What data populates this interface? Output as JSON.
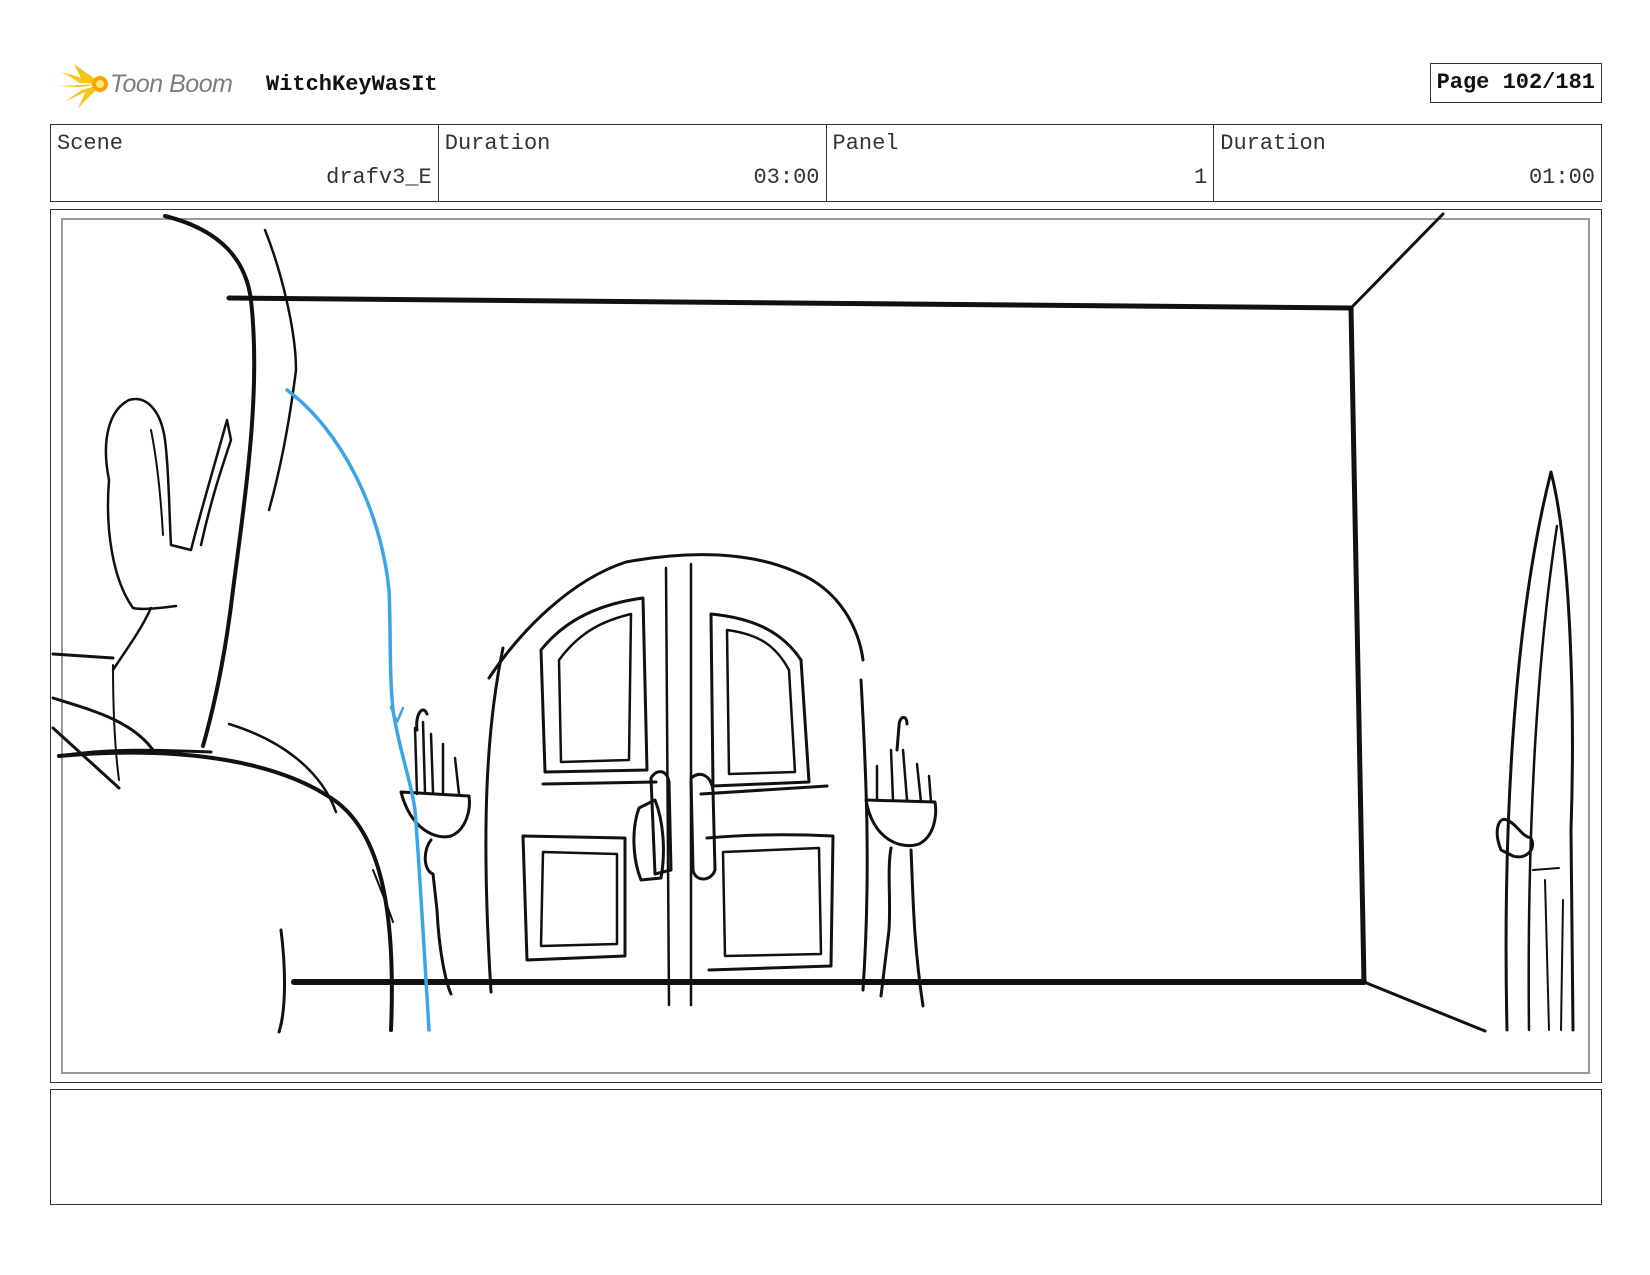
{
  "header": {
    "brand": "Toon Boom",
    "project_title": "WitchKeyWasIt",
    "page_label": "Page 102/181"
  },
  "info": [
    {
      "label": "Scene",
      "value": "drafv3_E"
    },
    {
      "label": "Duration",
      "value": "03:00"
    },
    {
      "label": "Panel",
      "value": "1"
    },
    {
      "label": "Duration",
      "value": "01:00"
    }
  ],
  "panel": {
    "image": "storyboard sketch",
    "stroke_color": "#111111",
    "guide_color": "#3aa6e6"
  },
  "notes": {
    "text": ""
  },
  "colors": {
    "logo_star": "#f5c518",
    "logo_text": "#7d7d7d",
    "border": "#333333"
  }
}
